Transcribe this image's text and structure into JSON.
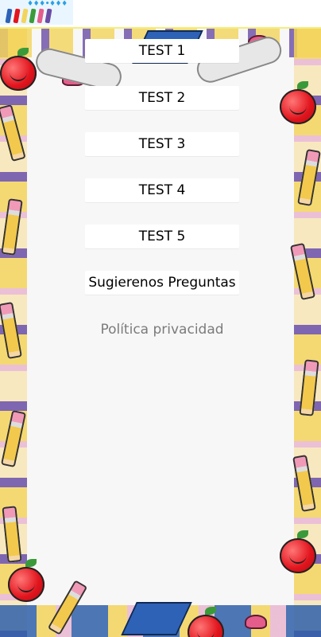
{
  "header": {
    "logo_text": "♦♦♦•♦♦♦"
  },
  "menu": {
    "items": [
      {
        "label": "TEST 1"
      },
      {
        "label": "TEST 2"
      },
      {
        "label": "TEST 3"
      },
      {
        "label": "TEST 4"
      },
      {
        "label": "TEST 5"
      },
      {
        "label": "Sugierenos Preguntas"
      }
    ],
    "privacy_label": "Política privacidad"
  },
  "icons": {
    "logo": "pencils-logo",
    "decor": [
      "apple-icon",
      "pencil-icon",
      "bow-icon",
      "graduation-cap-icon",
      "diploma-scroll-icon"
    ]
  },
  "colors": {
    "button_bg": "#ffffff",
    "button_text": "#000000",
    "link_text": "#7b7b7b",
    "frame_bg": "#f7f7f7",
    "accent_yellow": "#f3d45b",
    "accent_red": "#e2141d",
    "accent_blue": "#2e62b6"
  }
}
